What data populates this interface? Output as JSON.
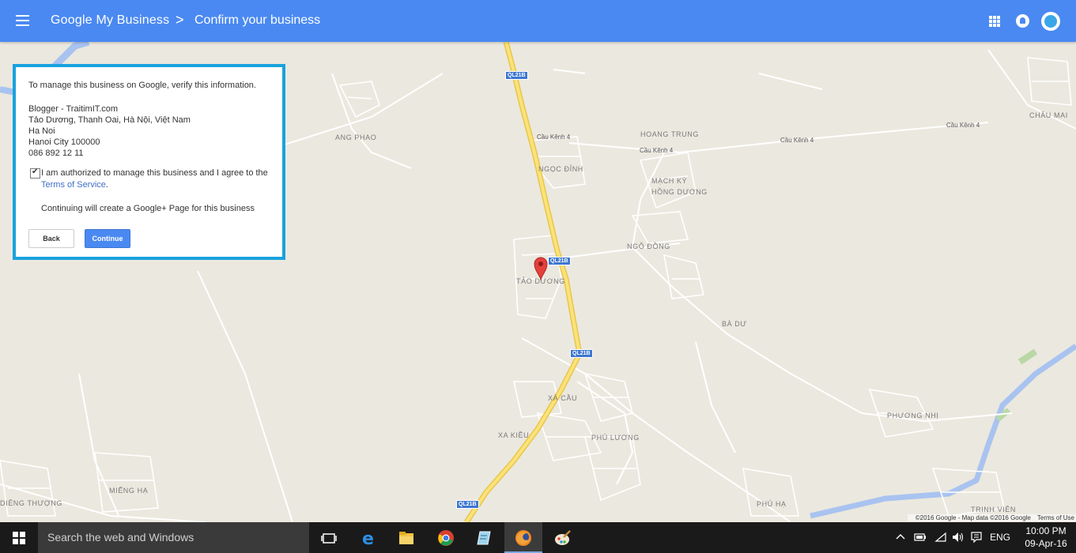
{
  "appbar": {
    "menu_icon": "hamburger-menu-icon",
    "title": "Google My Business",
    "separator": ">",
    "page": "Confirm your business",
    "icons": [
      "apps-grid-icon",
      "notifications-icon",
      "account-avatar"
    ]
  },
  "card": {
    "intro": "To manage this business on Google, verify this information.",
    "business_name": "Blogger - TraitimIT.com",
    "address_line1": "Tảo Dương, Thanh Oai, Hà Nội, Việt Nam",
    "address_line2": "Ha Noi",
    "address_line3": "Hanoi City 100000",
    "phone": "086 892 12 11",
    "authorized_checked": true,
    "agree_text": "I am authorized to manage this business and I agree to the",
    "terms_link": "Terms of Service",
    "terms_period": ".",
    "info": "Continuing will create a Google+ Page for this business",
    "back_button": "Back",
    "continue_button": "Continue"
  },
  "map": {
    "places": {
      "ang_phao": "ANG PHAO",
      "hoang_trung": "HOANG TRUNG",
      "chau_mai": "CHÂU MAI",
      "ngoc_dinh": "NGỌC ĐỈNH",
      "mach_ky": "MẠCH KỲ",
      "hong_duong": "HỒNG DƯƠNG",
      "ngo_dong": "NGÔ ĐỒNG",
      "tao_duong": "TẢO DƯƠNG",
      "ba_du": "BÀ DƯ",
      "xa_cau": "XÀ CẦU",
      "xa_kieu": "XA KIỀU",
      "phu_luong": "PHÚ LƯƠNG",
      "phuong_nhi": "PHƯƠNG NHỊ",
      "mieng_ha": "MIẾNG HẠ",
      "dieng_thuong": "DIÊNG THƯỢNG",
      "phu_ha": "PHÚ HẠ",
      "trinh_vien": "TRINH VIÊN"
    },
    "roads": {
      "cau_kenh_a": "Cầu Kênh 4",
      "cau_kenh_b": "Cầu Kênh 4",
      "cau_kenh_c": "Cầu Kênh 4",
      "cau_kenh_d": "Cầu Kênh 4"
    },
    "route_shield": "QL21B",
    "marker_icon": "map-pin-icon",
    "copyright": "©2016 Google - Map data ©2016 Google",
    "terms": "Terms of Use"
  },
  "taskbar": {
    "search_placeholder": "Search the web and Windows",
    "apps": [
      "task-view-icon",
      "edge-icon",
      "file-explorer-icon",
      "chrome-icon",
      "notepad-icon",
      "firefox-icon",
      "paint-icon"
    ],
    "language": "ENG",
    "time": "10:00 PM",
    "date": "09-Apr-16"
  }
}
